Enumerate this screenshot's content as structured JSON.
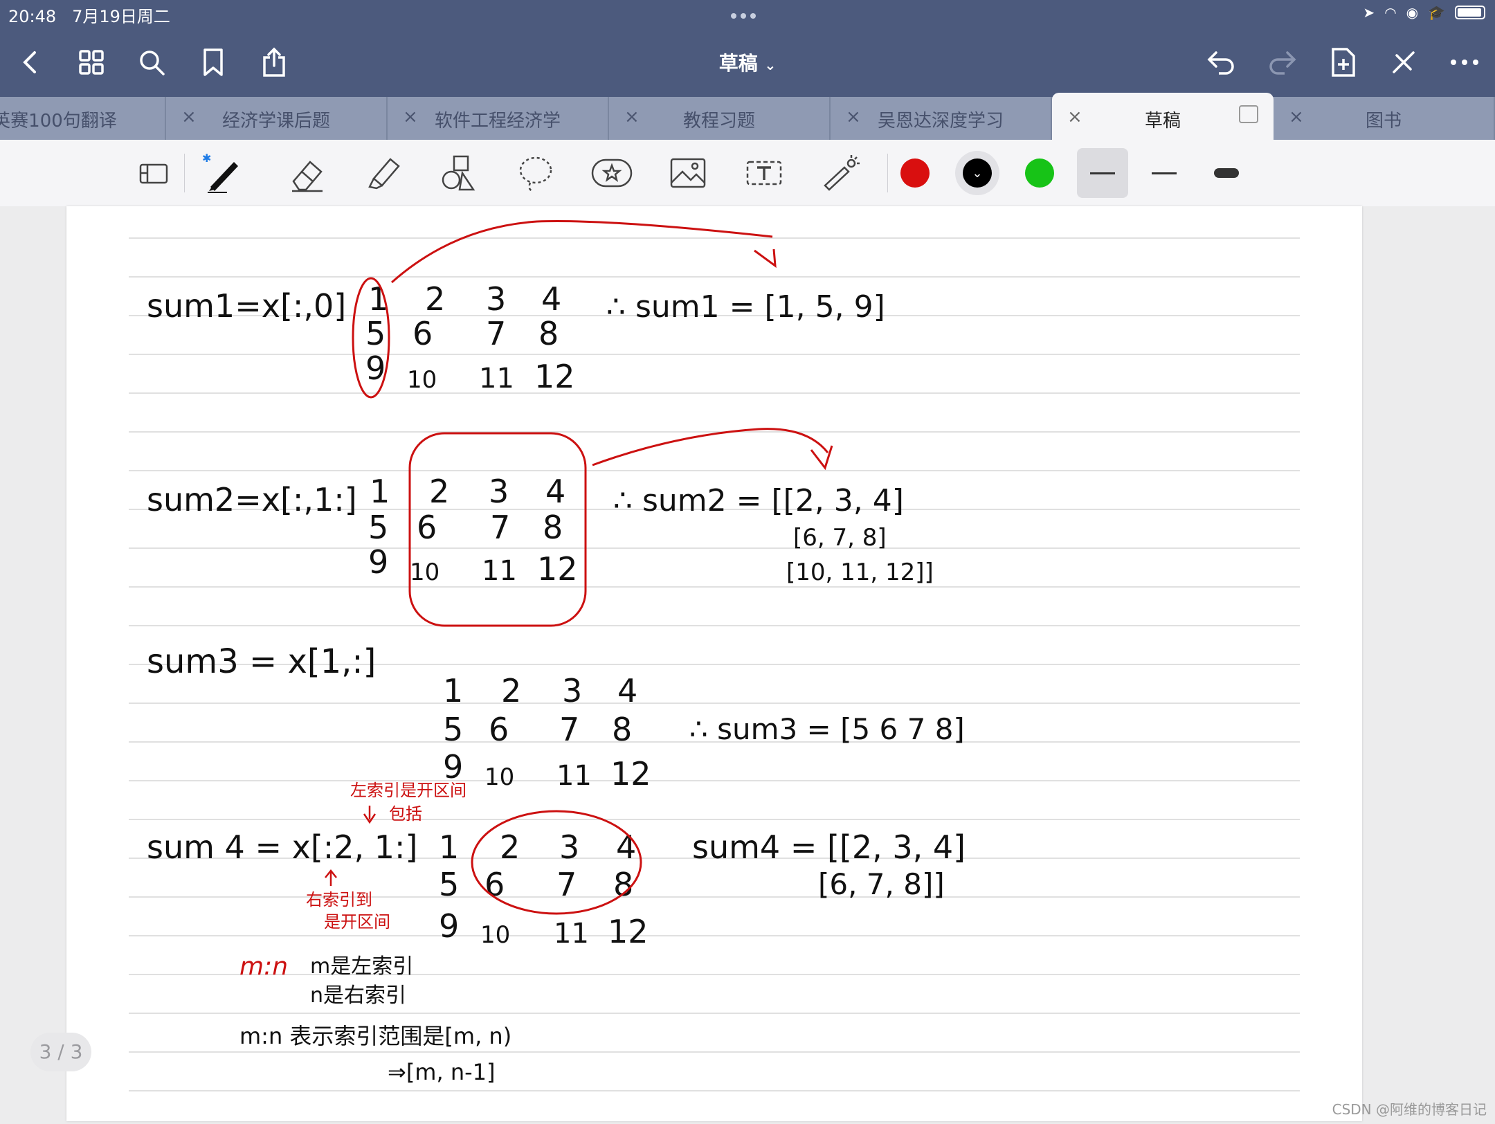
{
  "status": {
    "time": "20:48",
    "date": "7月19日周二"
  },
  "toolbar": {
    "title": "草稿",
    "icons": [
      "back-icon",
      "grid-icon",
      "search-icon",
      "bookmark-icon",
      "share-icon",
      "undo-icon",
      "redo-icon",
      "add-page-icon",
      "close-pen-icon",
      "more-icon"
    ]
  },
  "tabs": [
    {
      "label": "英赛100句翻译"
    },
    {
      "label": "经济学课后题"
    },
    {
      "label": "软件工程经济学"
    },
    {
      "label": "教程习题"
    },
    {
      "label": "吴恩达深度学习"
    },
    {
      "label": "草稿"
    },
    {
      "label": "图书"
    }
  ],
  "drawing_tools": {
    "colors": [
      "#d90f0f",
      "#000000",
      "#17c317"
    ],
    "selected_color": "#000000"
  },
  "notes": {
    "sum1_expr": "sum1=x[:,0]",
    "sum1_result": "∴ sum1 = [1, 5, 9]",
    "sum2_expr": "sum2=x[:,1:]",
    "sum2_result_row1": "∴ sum2 = [[2, 3, 4]",
    "sum2_result_row2": "[6, 7, 8]",
    "sum2_result_row3": "[10, 11, 12]]",
    "sum3_expr": "sum3 = x[1,:]",
    "sum3_result": "∴ sum3 = [5  6  7  8]",
    "sum4_expr": "sum 4 = x[:2, 1:]",
    "sum4_result_row1": "sum4 = [[2, 3, 4]",
    "sum4_result_row2": "[6, 7, 8]]",
    "annot_left_index": "左索引是开区间",
    "annot_include": "包括",
    "annot_right_index": "右索引到",
    "annot_open_interval": "是开区间",
    "mn_label": "m:n",
    "mn_left": "m是左索引",
    "mn_right": "n是右索引",
    "mn_range": "m:n 表示索引范围是[m, n)",
    "mn_range2": "⇒[m, n-1]",
    "matrix": [
      [
        "1",
        "2",
        "3",
        "4"
      ],
      [
        "5",
        "6",
        "7",
        "8"
      ],
      [
        "9",
        "10",
        "11",
        "12"
      ]
    ]
  },
  "page_indicator": "3 / 3",
  "watermark": "CSDN @阿维的博客日记"
}
